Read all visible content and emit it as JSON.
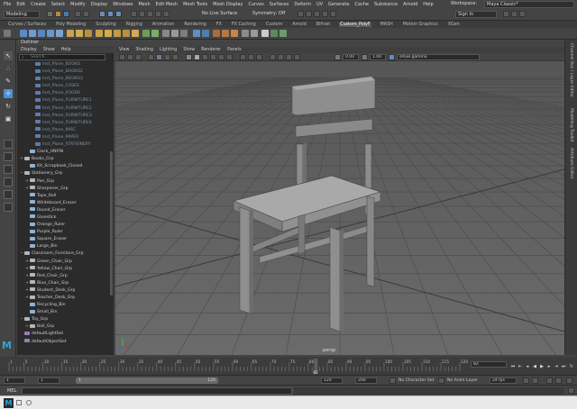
{
  "menubar": [
    "File",
    "Edit",
    "Create",
    "Select",
    "Modify",
    "Display",
    "Windows",
    "Mesh",
    "Edit Mesh",
    "Mesh Tools",
    "Mesh Display",
    "Curves",
    "Surfaces",
    "Deform",
    "UV",
    "Generate",
    "Cache",
    "Substance",
    "Arnold",
    "Help"
  ],
  "workspace": {
    "label": "Workspace:",
    "value": "Maya Classic*"
  },
  "menuset": "Modeling",
  "statusline": {
    "live_surface": "No Live Surface",
    "symmetry": "Symmetry: Off",
    "sign_in": "Sign In"
  },
  "shelf_tabs": [
    "Curves / Surfaces",
    "Poly Modeling",
    "Sculpting",
    "Rigging",
    "Animation",
    "Rendering",
    "FX",
    "FX Caching",
    "Custom",
    "Arnold",
    "Bifrost",
    "Custom_PolyF",
    "MASH",
    "Motion Graphics",
    "XGen"
  ],
  "active_shelf_tab": "Custom_PolyF",
  "outliner": {
    "title": "Outliner",
    "menu": [
      "Display",
      "Show",
      "Help"
    ],
    "search_placeholder": "Search...",
    "rows": [
      {
        "label": "Inst_Plane_BOOKS",
        "indent": 2,
        "dim": true,
        "icon": "plane"
      },
      {
        "label": "Inst_Plane_BOOKS2",
        "indent": 2,
        "dim": true,
        "icon": "plane"
      },
      {
        "label": "Inst_Plane_BOOKS3",
        "indent": 2,
        "dim": true,
        "icon": "plane"
      },
      {
        "label": "Inst_Plane_CASES",
        "indent": 2,
        "dim": true,
        "icon": "plane"
      },
      {
        "label": "Inst_Plane_FOODS",
        "indent": 2,
        "dim": true,
        "icon": "plane"
      },
      {
        "label": "Inst_Plane_FURNITURE1",
        "indent": 2,
        "dim": true,
        "icon": "plane"
      },
      {
        "label": "Inst_Plane_FURNITURE2",
        "indent": 2,
        "dim": true,
        "icon": "plane"
      },
      {
        "label": "Inst_Plane_FURNITURE3",
        "indent": 2,
        "dim": true,
        "icon": "plane"
      },
      {
        "label": "Inst_Plane_FURNITURE4",
        "indent": 2,
        "dim": true,
        "icon": "plane"
      },
      {
        "label": "Inst_Plane_MISC",
        "indent": 2,
        "dim": true,
        "icon": "plane"
      },
      {
        "label": "Inst_Plane_PAPER",
        "indent": 2,
        "dim": true,
        "icon": "plane"
      },
      {
        "label": "Inst_Plane_STATIONERY",
        "indent": 2,
        "dim": true,
        "icon": "plane"
      },
      {
        "label": "Clock_UNFIN",
        "indent": 1,
        "dim": false,
        "icon": "mesh"
      },
      {
        "label": "Books_Grp",
        "indent": 0,
        "expand": "+",
        "icon": "group"
      },
      {
        "label": "Kit_Scrapbook_Closed",
        "indent": 1,
        "icon": "mesh"
      },
      {
        "label": "Stationery_Grp",
        "indent": 0,
        "expand": "-",
        "icon": "group"
      },
      {
        "label": "Pen_Grp",
        "indent": 1,
        "expand": "+",
        "icon": "group"
      },
      {
        "label": "Sharpener_Grp",
        "indent": 1,
        "expand": "+",
        "icon": "group"
      },
      {
        "label": "Tape_Roll",
        "indent": 1,
        "icon": "mesh"
      },
      {
        "label": "Whiteboard_Eraser",
        "indent": 1,
        "icon": "mesh"
      },
      {
        "label": "Round_Eraser",
        "indent": 1,
        "icon": "mesh"
      },
      {
        "label": "Gluestick",
        "indent": 1,
        "icon": "mesh"
      },
      {
        "label": "Orange_Ruler",
        "indent": 1,
        "icon": "mesh"
      },
      {
        "label": "Purple_Ruler",
        "indent": 1,
        "icon": "mesh"
      },
      {
        "label": "Square_Eraser",
        "indent": 1,
        "icon": "mesh"
      },
      {
        "label": "Large_Bin",
        "indent": 1,
        "icon": "mesh"
      },
      {
        "label": "Classroom_Furniture_Grp",
        "indent": 0,
        "expand": "-",
        "icon": "group"
      },
      {
        "label": "Green_Chair_Grp",
        "indent": 1,
        "expand": "+",
        "icon": "group"
      },
      {
        "label": "Yellow_Chair_Grp",
        "indent": 1,
        "expand": "+",
        "icon": "group"
      },
      {
        "label": "Red_Chair_Grp",
        "indent": 1,
        "expand": "+",
        "icon": "group"
      },
      {
        "label": "Blue_Chair_Grp",
        "indent": 1,
        "expand": "+",
        "icon": "group"
      },
      {
        "label": "Student_Desk_Grp",
        "indent": 1,
        "expand": "+",
        "icon": "group"
      },
      {
        "label": "Teacher_Desk_Grp",
        "indent": 1,
        "expand": "+",
        "icon": "group"
      },
      {
        "label": "Recycling_Bin",
        "indent": 1,
        "icon": "mesh"
      },
      {
        "label": "Small_Bin",
        "indent": 1,
        "icon": "mesh"
      },
      {
        "label": "Toy_Grp",
        "indent": 0,
        "expand": "-",
        "icon": "group"
      },
      {
        "label": "Ball_Grp",
        "indent": 1,
        "expand": "+",
        "icon": "group"
      },
      {
        "label": "defaultLightSet",
        "indent": 0,
        "icon": "set"
      },
      {
        "label": "defaultObjectSet",
        "indent": 0,
        "icon": "set"
      }
    ]
  },
  "viewport": {
    "menu": [
      "View",
      "Shading",
      "Lighting",
      "Show",
      "Renderer",
      "Panels"
    ],
    "camera_label": "persp",
    "exposure": "0.00",
    "gamma": "1.00",
    "colorspace": "sRGB gamma"
  },
  "right_tabs": [
    "Channel Box / Layer Editor",
    "Modelling Toolkit",
    "Attribute Editor"
  ],
  "timeslider": {
    "ticks": [
      "1",
      "5",
      "10",
      "15",
      "20",
      "25",
      "30",
      "35",
      "40",
      "45",
      "50",
      "55",
      "60",
      "65",
      "70",
      "75",
      "80",
      "85",
      "90",
      "95",
      "100",
      "105",
      "110",
      "115",
      "120"
    ],
    "current_frame": "82",
    "current_field": "82"
  },
  "range": {
    "start": "1",
    "inner_start": "1",
    "slider_end": "120",
    "range_end": "120",
    "end": "200",
    "character_set": "No Character Set",
    "anim_layer": "No Anim Layer",
    "fps": "24 fps"
  },
  "cmdline": {
    "label": "MEL"
  },
  "taskbar": {
    "app": "M"
  }
}
